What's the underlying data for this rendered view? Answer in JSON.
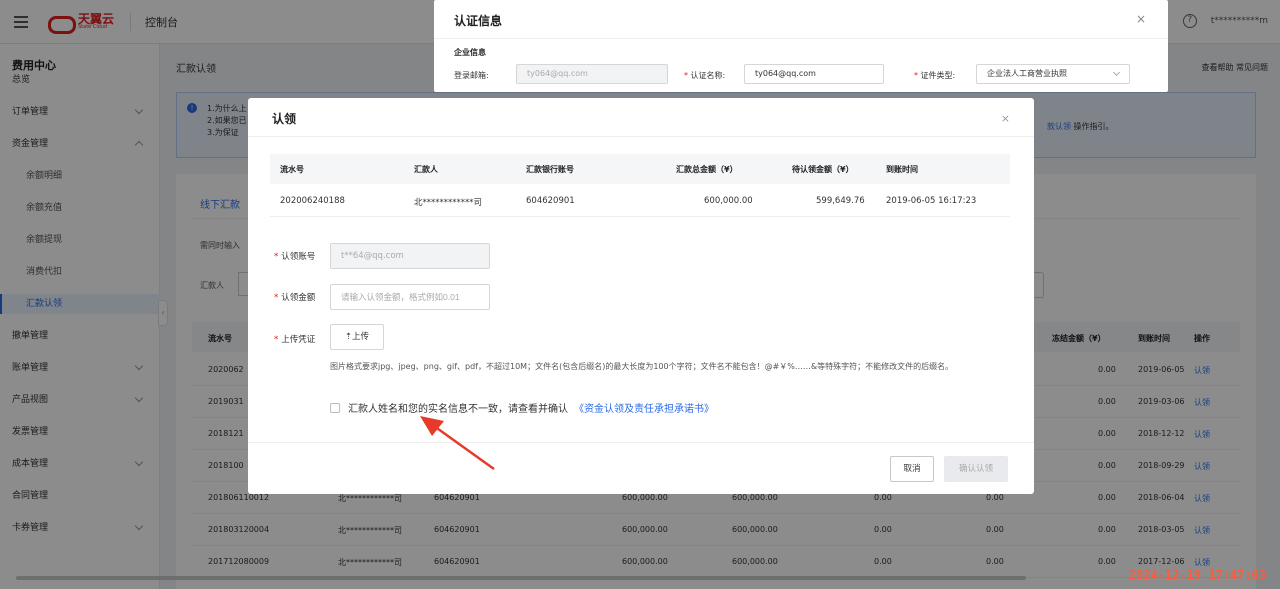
{
  "topbar": {
    "brand": "天翼云",
    "brand_sub": "State Cloud",
    "console": "控制台",
    "help": "?",
    "user": "t**********m"
  },
  "sidebar": {
    "title": "费用中心",
    "items": [
      {
        "label": "总览",
        "type": "top",
        "chev": ""
      },
      {
        "label": "订单管理",
        "type": "top",
        "chev": "down"
      },
      {
        "label": "资金管理",
        "type": "top",
        "chev": "up"
      },
      {
        "label": "余额明细",
        "type": "sub",
        "chev": ""
      },
      {
        "label": "余额充值",
        "type": "sub",
        "chev": ""
      },
      {
        "label": "余额提现",
        "type": "sub",
        "chev": ""
      },
      {
        "label": "消费代扣",
        "type": "sub",
        "chev": ""
      },
      {
        "label": "汇款认领",
        "type": "active",
        "chev": ""
      },
      {
        "label": "撤单管理",
        "type": "top",
        "chev": ""
      },
      {
        "label": "账单管理",
        "type": "top",
        "chev": "down"
      },
      {
        "label": "产品视图",
        "type": "top",
        "chev": "down"
      },
      {
        "label": "发票管理",
        "type": "top",
        "chev": ""
      },
      {
        "label": "成本管理",
        "type": "top",
        "chev": "down"
      },
      {
        "label": "合同管理",
        "type": "top",
        "chev": ""
      },
      {
        "label": "卡券管理",
        "type": "top",
        "chev": "down"
      }
    ]
  },
  "background": {
    "breadcrumb": "汇款认领",
    "toplinks": "查看帮助  常见问题",
    "notice_lines": [
      "1.为什么上",
      "2.如果您已",
      "3.为保证"
    ],
    "notice_tail": "款认领",
    "notice_tail2": " 操作指引。",
    "tab": "线下汇款",
    "hint": "需同时输入",
    "remitter_label": "汇款人",
    "right_headers": [
      "冻结金额（¥）",
      "到账时间",
      "操作"
    ],
    "rows": [
      {
        "id": "2020062",
        "name": "",
        "acct": "",
        "total": "",
        "pending": "",
        "c1": "",
        "frozen": "0.00",
        "time": "2019-06-05",
        "op": "认领"
      },
      {
        "id": "2019031",
        "name": "",
        "acct": "",
        "total": "",
        "pending": "",
        "c1": "",
        "frozen": "0.00",
        "time": "2019-03-06",
        "op": "认领"
      },
      {
        "id": "2018121",
        "name": "",
        "acct": "",
        "total": "",
        "pending": "",
        "c1": "",
        "frozen": "0.00",
        "time": "2018-12-12",
        "op": "认领"
      },
      {
        "id": "2018100",
        "name": "",
        "acct": "",
        "total": "",
        "pending": "",
        "c1": "",
        "frozen": "0.00",
        "time": "2018-09-29",
        "op": "认领"
      },
      {
        "id": "201806110012",
        "name": "北************司",
        "acct": "604620901",
        "total": "600,000.00",
        "pending": "600,000.00",
        "c1": "0.00",
        "c2": "0.00",
        "frozen": "0.00",
        "time": "2018-06-04",
        "op": "认领"
      },
      {
        "id": "201803120004",
        "name": "北************司",
        "acct": "604620901",
        "total": "600,000.00",
        "pending": "600,000.00",
        "c1": "0.00",
        "c2": "0.00",
        "frozen": "0.00",
        "time": "2018-03-05",
        "op": "认领"
      },
      {
        "id": "201712080009",
        "name": "北************司",
        "acct": "604620901",
        "total": "600,000.00",
        "pending": "600,000.00",
        "c1": "0.00",
        "c2": "0.00",
        "frozen": "0.00",
        "time": "2017-12-06",
        "op": "认领"
      }
    ],
    "first_header": "流水号"
  },
  "cert_modal": {
    "title": "认证信息",
    "close": "×",
    "section": "企业信息",
    "email_label": "登录邮箱:",
    "email_value": "ty064@qq.com",
    "name_label": "认证名称:",
    "name_value": "ty064@qq.com",
    "type_label": "证件类型:",
    "type_value": "企业法人工商营业执照"
  },
  "claim_modal": {
    "title": "认领",
    "close": "×",
    "headers": [
      "流水号",
      "汇款人",
      "汇款银行账号",
      "汇款总金额（¥）",
      "待认领金额（¥）",
      "到账时间"
    ],
    "row": [
      "202006240188",
      "北************司",
      "604620901",
      "600,000.00",
      "599,649.76",
      "2019-06-05 16:17:23"
    ],
    "account_label": "认领账号",
    "account_value": "t**64@qq.com",
    "amount_label": "认领金额",
    "amount_placeholder": "请输入认领金额，格式例如0.01",
    "upload_label": "上传凭证",
    "upload_button": "上传",
    "upload_note": "图片格式要求jpg、jpeg、png、gif、pdf，不超过10M；文件名(包含后缀名)的最大长度为100个字符；文件名不能包含！@#￥%……&等特殊字符；不能修改文件的后缀名。",
    "agree_text": "汇款人姓名和您的实名信息不一致，请查看并确认",
    "agree_link": "《资金认领及责任承担承诺书》",
    "cancel": "取消",
    "confirm": "确认认领"
  },
  "timestamp": "2024-12-19 17:47:03",
  "colors": {
    "accent": "#2b6be5",
    "brand": "#e0201f",
    "annotation": "#e83a2a"
  }
}
